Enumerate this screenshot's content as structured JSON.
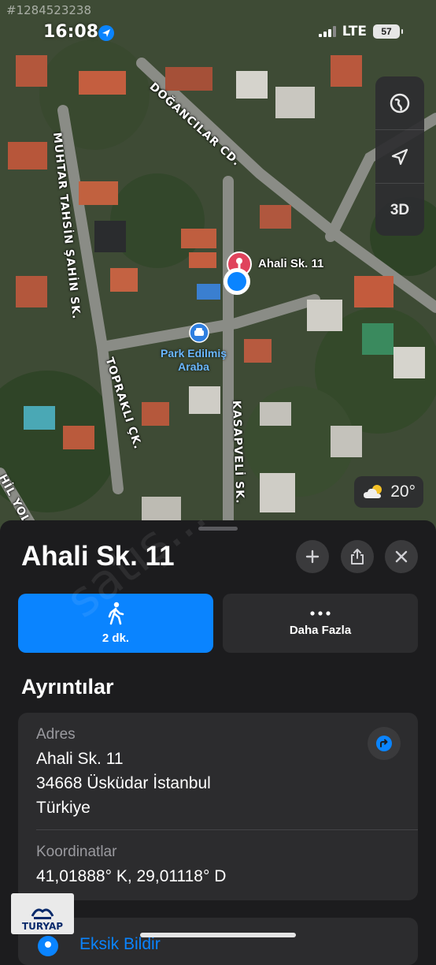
{
  "watermark_id": "#1284523238",
  "status_bar": {
    "time": "16:08",
    "network": "LTE",
    "battery": "57"
  },
  "map": {
    "streets": [
      "DOĞANCILAR CD.",
      "MUHTAR TAHSİN ŞAHİN SK.",
      "TOPRAKLI ÇK.",
      "KASAPVELİ SK.",
      "HİL YOLU"
    ],
    "controls": {
      "globe_icon": "globe-icon",
      "location_icon": "location-arrow-icon",
      "three_d": "3D"
    },
    "pin_label": "Ahali Sk. 11",
    "parked_car_line1": "Park Edilmiş",
    "parked_car_line2": "Araba",
    "weather": "20°",
    "accent_pin": "#e0435c",
    "accent_location": "#0a84ff"
  },
  "sheet": {
    "title": "Ahali Sk. 11",
    "walk_button": "2 dk.",
    "more_button": "Daha Fazla",
    "details_title": "Ayrıntılar",
    "address_label": "Adres",
    "address_lines": [
      "Ahali Sk. 11",
      "34668 Üsküdar İstanbul",
      "Türkiye"
    ],
    "coords_label": "Koordinatlar",
    "coords_value": "41,01888° K, 29,01118° D",
    "report_label": "Eksik Bildir",
    "logo": "TURYAP",
    "watermark": "satış..."
  }
}
